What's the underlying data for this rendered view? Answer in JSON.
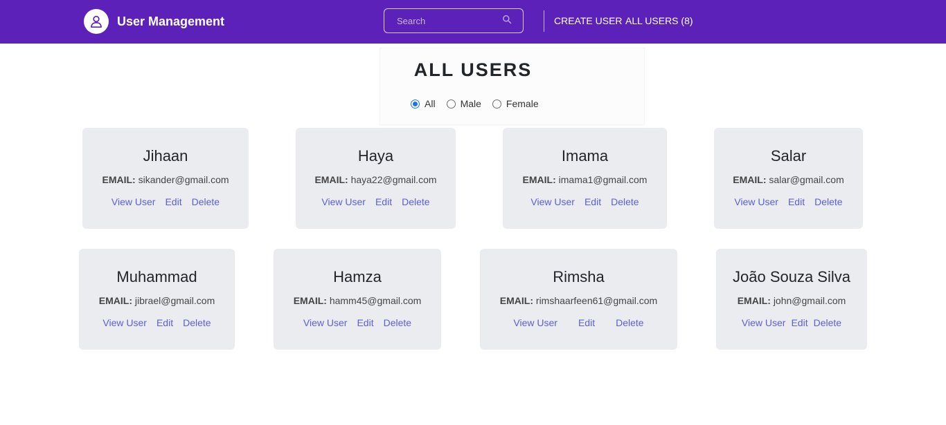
{
  "header": {
    "brand_title": "User Management",
    "brand_icon": "user-icon",
    "search_placeholder": "Search",
    "search_value": "",
    "create_user_label": "CREATE USER",
    "all_users_label": "ALL USERS (8)"
  },
  "main": {
    "title": "ALL USERS",
    "filters": [
      {
        "label": "All",
        "checked": true
      },
      {
        "label": "Male",
        "checked": false
      },
      {
        "label": "Female",
        "checked": false
      }
    ],
    "email_label": "EMAIL:",
    "actions": {
      "view": "View User",
      "edit": "Edit",
      "delete": "Delete"
    },
    "users": [
      {
        "name": "Jihaan",
        "email": "sikander@gmail.com"
      },
      {
        "name": "Haya",
        "email": "haya22@gmail.com"
      },
      {
        "name": "Imama",
        "email": "imama1@gmail.com"
      },
      {
        "name": "Salar",
        "email": "salar@gmail.com"
      },
      {
        "name": "Muhammad",
        "email": "jibrael@gmail.com"
      },
      {
        "name": "Hamza",
        "email": "hamm45@gmail.com"
      },
      {
        "name": "Rimsha",
        "email": "rimshaarfeen61@gmail.com"
      },
      {
        "name": "João Souza Silva",
        "email": "john@gmail.com"
      }
    ]
  },
  "colors": {
    "navbar": "#5c21b8",
    "card_bg": "#ebecf0",
    "link": "#5a5fd6",
    "radio_accent": "#1a73e8"
  }
}
